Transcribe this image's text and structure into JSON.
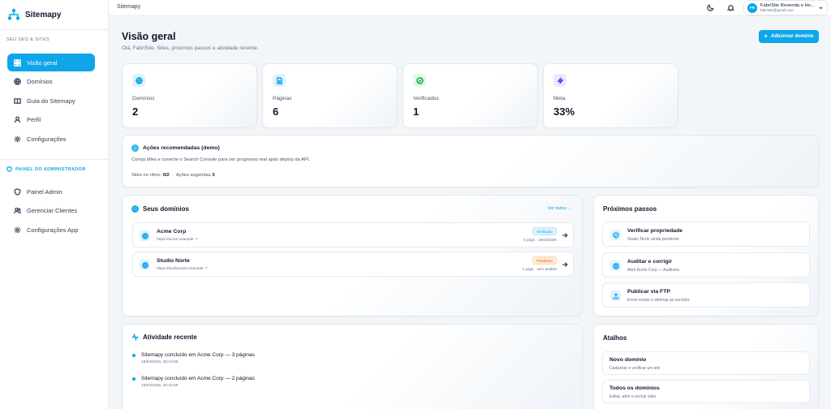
{
  "app": {
    "logo_text": "Sitemapy",
    "breadcrumb": "Sitemapy"
  },
  "sidebar": {
    "section_label": "SEU SEO & SITES",
    "items": [
      {
        "label": "Visão geral",
        "icon": "dashboard-icon",
        "active": true
      },
      {
        "label": "Domínios",
        "icon": "globe-icon"
      },
      {
        "label": "Guia do Sitemapy",
        "icon": "book-icon"
      },
      {
        "label": "Perfil",
        "icon": "user-icon"
      },
      {
        "label": "Configurações",
        "icon": "gear-icon"
      }
    ],
    "admin_label": "PAINEL DO ADMINISTRADOR",
    "admin_items": [
      {
        "label": "Painel Admin",
        "icon": "shield-icon"
      },
      {
        "label": "Gerenciar Clientes",
        "icon": "users-icon"
      },
      {
        "label": "Configurações App",
        "icon": "gear-icon"
      }
    ]
  },
  "topbar": {
    "user_initials": "FR",
    "user_name": "FabriSite Revenda e Ho...",
    "user_email": "fabrisite@gmail.com"
  },
  "header": {
    "title": "Visão geral",
    "subtitle": "Olá, FabriSite. Sites, próximos passos e atividade recente.",
    "add_domain_label": "Adicionar domínio"
  },
  "stats": [
    {
      "label": "Domínios",
      "value": "2",
      "icon": "globe-icon",
      "color": "#0ea5e9",
      "bg": "#e0f2fe"
    },
    {
      "label": "Páginas",
      "value": "6",
      "icon": "file-icon",
      "color": "#0ea5e9",
      "bg": "#e0f2fe"
    },
    {
      "label": "Verificados",
      "value": "1",
      "icon": "check-circle-icon",
      "color": "#16a34a",
      "bg": "#dcfce7"
    },
    {
      "label": "Meta",
      "value": "33%",
      "icon": "bolt-icon",
      "color": "#7c3aed",
      "bg": "#ede9fe"
    }
  ],
  "recommended": {
    "title": "Ações recomendadas (demo)",
    "text": "Corrija títles e conecte o Search Console para ver progresso real após deploy da API.",
    "sites_label": "Sites no ritmo:",
    "sites_value": "0/2",
    "actions_label": "Ações sugeridas",
    "actions_value": "3"
  },
  "domains": {
    "title": "Seus domínios",
    "view_all": "Ver todos →",
    "rows": [
      {
        "name": "Acme Corp",
        "url": "https://acme.example ↗",
        "badge": "Verificado",
        "status": "ok",
        "meta": "5 págs · 19/03/2026"
      },
      {
        "name": "Studio Norte",
        "url": "https://studionorte.example ↗",
        "badge": "Pendente",
        "status": "pending",
        "meta": "1 págs · sem análise"
      }
    ]
  },
  "next_steps": {
    "title": "Próximos passos",
    "items": [
      {
        "title": "Verificar propriedade",
        "sub": "Studio Norte ainda pendente",
        "icon": "shield-check-icon"
      },
      {
        "title": "Auditar e corrigir",
        "sub": "Abrir Acme Corp — Auditoria",
        "icon": "target-icon"
      },
      {
        "title": "Publicar via FTP",
        "sub": "Envie metas e sitemap ao servidor",
        "icon": "upload-icon"
      }
    ]
  },
  "activity": {
    "title": "Atividade recente",
    "items": [
      {
        "text": "Sitemapy concluído em Acme Corp — 3 páginas",
        "time": "19/03/2026, 20:10:58"
      },
      {
        "text": "Sitemapy concluído em Acme Corp — 2 páginas",
        "time": "18/03/2026, 20:10:58"
      }
    ]
  },
  "shortcuts": {
    "title": "Atalhos",
    "items": [
      {
        "title": "Novo domínio",
        "sub": "Cadastrar e verificar um site"
      },
      {
        "title": "Todos os domínios",
        "sub": "Editar, abrir e excluir sites"
      }
    ]
  }
}
